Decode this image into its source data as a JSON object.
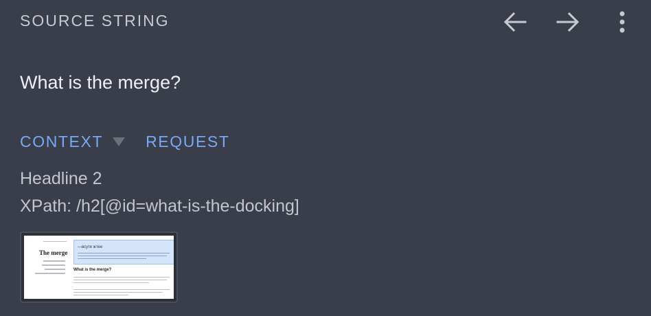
{
  "header": {
    "title": "SOURCE STRING",
    "back_icon": "arrow-left-icon",
    "forward_icon": "arrow-right-icon",
    "menu_icon": "more-vertical-icon"
  },
  "source": {
    "text": "What is the merge?"
  },
  "tabs": [
    {
      "label": "CONTEXT",
      "has_dropdown": true
    },
    {
      "label": "REQUEST",
      "has_dropdown": false
    }
  ],
  "context": {
    "type_label": "Headline 2",
    "xpath": "XPath: /h2[@id=what-is-the-docking]"
  },
  "screenshot_thumbnail": {
    "sidebar_title": "The merge",
    "hero_title": "—всуте жтее",
    "section_heading": "What is the merge?"
  },
  "colors": {
    "background": "#393e4a",
    "accent": "#78a9f7",
    "text_primary": "#eef0f3",
    "text_secondary": "#c3c6cc"
  }
}
